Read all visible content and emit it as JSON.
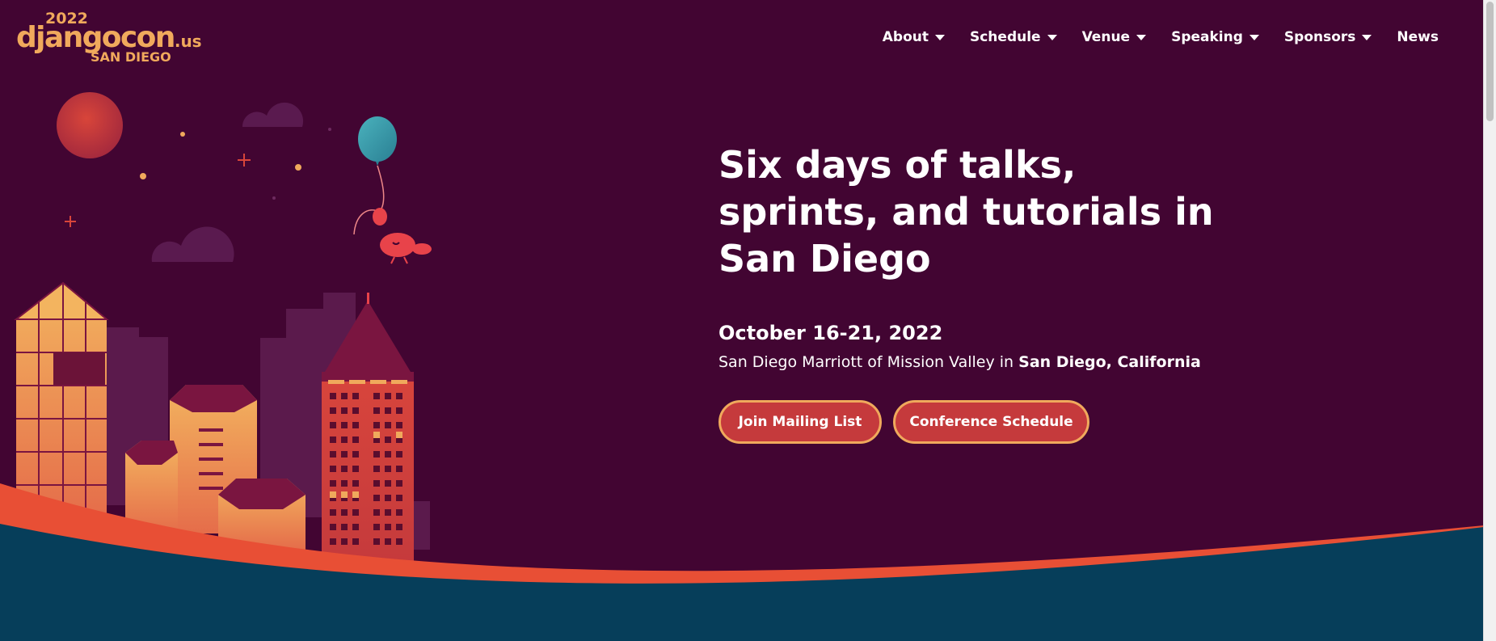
{
  "logo": {
    "year": "2022",
    "name": "djangocon",
    "tld": ".us",
    "city": "SAN DIEGO"
  },
  "nav": {
    "items": [
      {
        "label": "About",
        "dropdown": true
      },
      {
        "label": "Schedule",
        "dropdown": true
      },
      {
        "label": "Venue",
        "dropdown": true
      },
      {
        "label": "Speaking",
        "dropdown": true
      },
      {
        "label": "Sponsors",
        "dropdown": true
      },
      {
        "label": "News",
        "dropdown": false
      }
    ]
  },
  "hero": {
    "headline_lines": [
      "Six days of talks,",
      "sprints, and tutorials in",
      "San Diego"
    ],
    "date": "October 16-21, 2022",
    "venue_prefix": "San Diego Marriott of Mission Valley in",
    "venue_city": "San Diego, California",
    "buttons": {
      "mailing": "Join Mailing List",
      "schedule": "Conference Schedule"
    }
  },
  "colors": {
    "background": "#420532",
    "accent_orange": "#f0a95c",
    "button_red": "#c53a3c",
    "wave_orange": "#e84f35",
    "wave_teal": "#063e5a"
  }
}
